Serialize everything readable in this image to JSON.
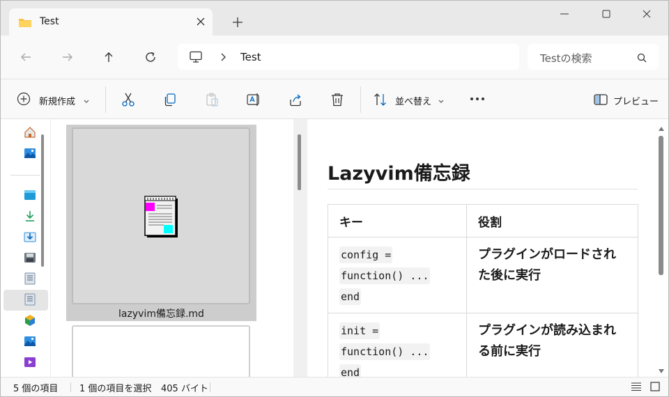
{
  "tab": {
    "title": "Test",
    "icon": "folder-icon"
  },
  "window_controls": {
    "minimize": "minimize-icon",
    "maximize": "maximize-icon",
    "close": "close-icon"
  },
  "address": {
    "segment": "Test",
    "search_placeholder": "Testの検索"
  },
  "commands": {
    "new": "新規作成",
    "sort": "並べ替え",
    "preview": "プレビュー"
  },
  "file": {
    "name": "lazyvim備忘録.md"
  },
  "preview": {
    "title": "Lazyvim備忘録",
    "headers": [
      "キー",
      "役割"
    ],
    "rows": [
      {
        "code": [
          "config =",
          "function() ...",
          "end"
        ],
        "desc": "プラグインがロードされた後に実行"
      },
      {
        "code": [
          "init =",
          "function() ...",
          "end"
        ],
        "desc": "プラグインが読み込まれる前に実行"
      }
    ]
  },
  "status": {
    "items": "5 個の項目",
    "selected": "1 個の項目を選択",
    "size": "405 バイト"
  },
  "colors": {
    "accent": "#0067c0",
    "selection": "#cdcdcd"
  }
}
